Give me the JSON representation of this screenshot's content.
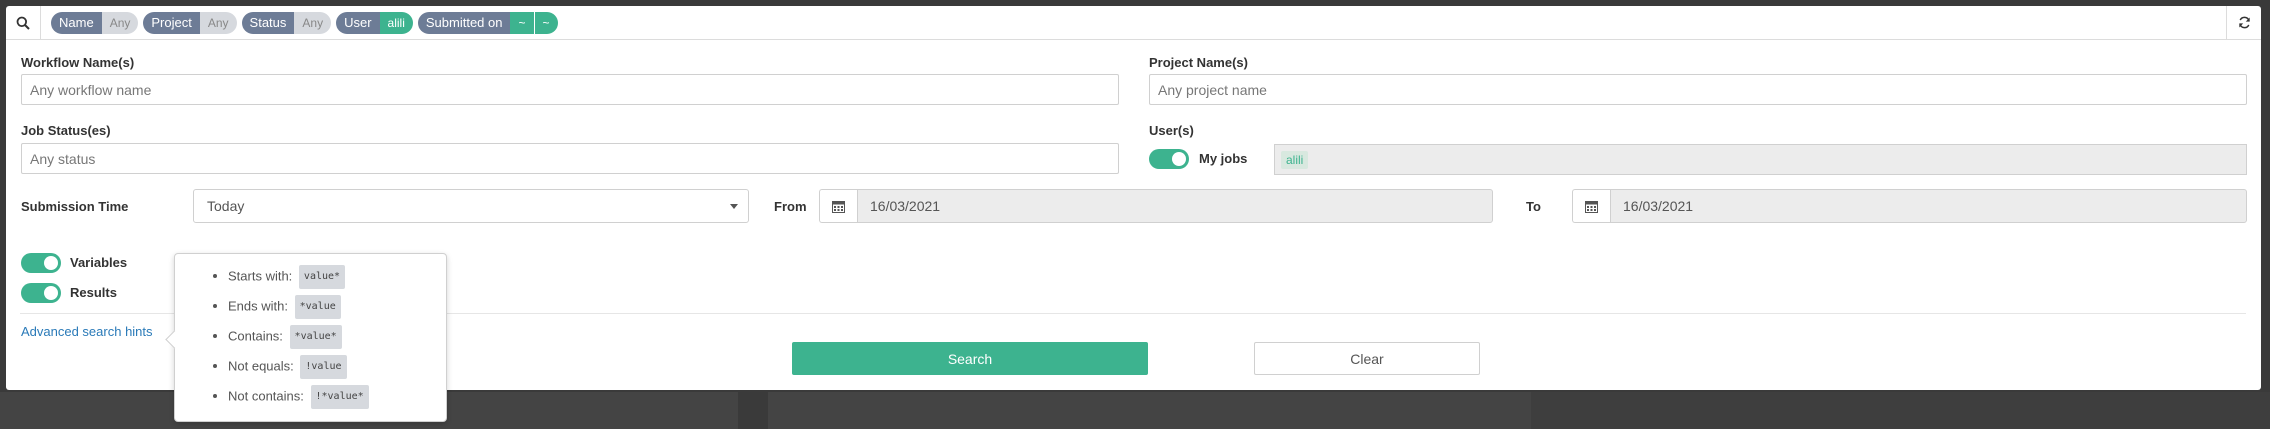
{
  "filter_tags": [
    {
      "key": "Name",
      "values": [
        "Any"
      ],
      "active": false
    },
    {
      "key": "Project",
      "values": [
        "Any"
      ],
      "active": false
    },
    {
      "key": "Status",
      "values": [
        "Any"
      ],
      "active": false
    },
    {
      "key": "User",
      "values": [
        "alili"
      ],
      "active": true
    },
    {
      "key": "Submitted on",
      "values": [
        "~",
        "~"
      ],
      "active": true
    }
  ],
  "fields": {
    "workflow_label": "Workflow Name(s)",
    "workflow_placeholder": "Any workflow name",
    "project_label": "Project Name(s)",
    "project_placeholder": "Any project name",
    "status_label": "Job Status(es)",
    "status_placeholder": "Any status",
    "users_label": "User(s)",
    "my_jobs_label": "My jobs",
    "user_chip": "alili",
    "submission_label": "Submission Time",
    "submission_value": "Today",
    "from_label": "From",
    "from_value": "16/03/2021",
    "to_label": "To",
    "to_value": "16/03/2021",
    "variables_label": "Variables",
    "results_label": "Results"
  },
  "hints": {
    "link": "Advanced search hints",
    "items": [
      {
        "label": "Starts with:",
        "code": "value*"
      },
      {
        "label": "Ends with:",
        "code": "*value"
      },
      {
        "label": "Contains:",
        "code": "*value*"
      },
      {
        "label": "Not equals:",
        "code": "!value"
      },
      {
        "label": "Not contains:",
        "code": "!*value*"
      }
    ]
  },
  "buttons": {
    "search": "Search",
    "clear": "Clear"
  },
  "icons": {
    "search": "search-icon",
    "refresh": "refresh-icon",
    "calendar": "calendar-icon"
  },
  "colors": {
    "accent": "#3db38f",
    "tag": "#6d7c96",
    "link": "#2a7ab8"
  }
}
